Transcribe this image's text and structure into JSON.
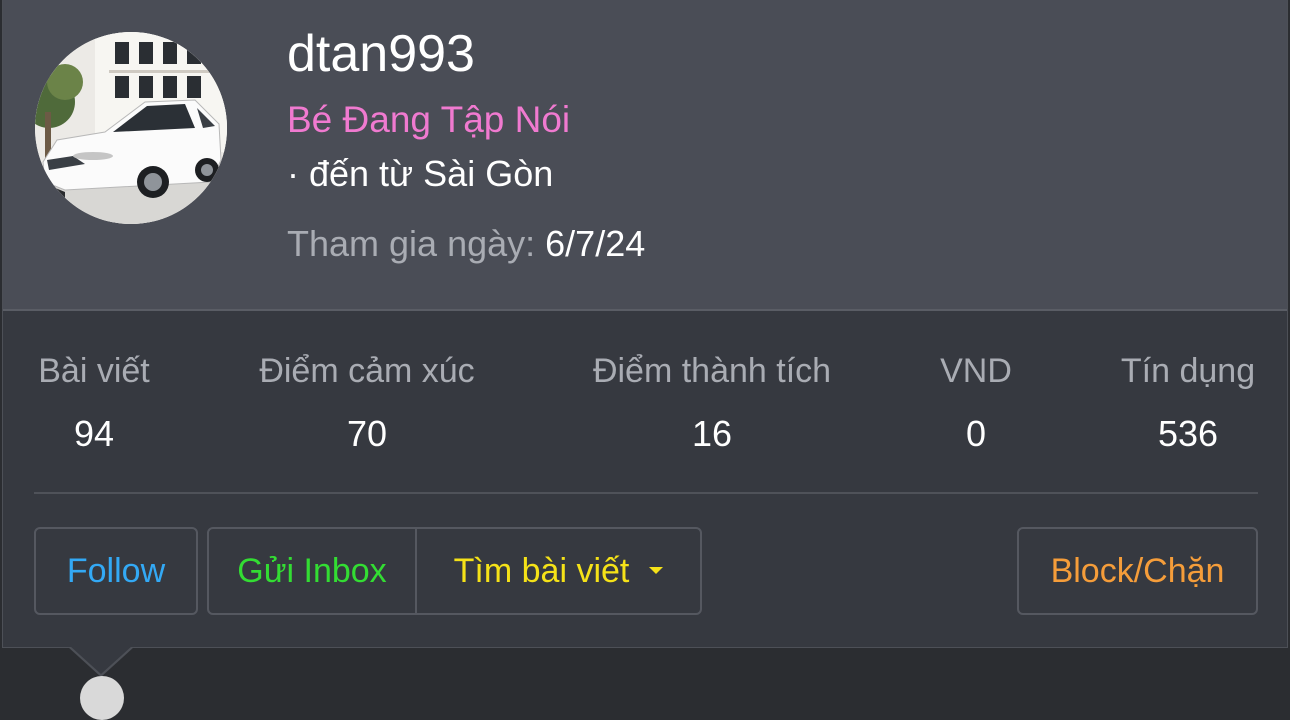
{
  "profile": {
    "username": "dtan993",
    "rank": "Bé Đang Tập Nói",
    "location": "· đến từ Sài Gòn",
    "joined_label": "Tham gia ngày:",
    "joined_value": "6/7/24",
    "avatar_icon": "car-photo-avatar"
  },
  "stats": [
    {
      "label": "Bài viết",
      "value": "94"
    },
    {
      "label": "Điểm cảm xúc",
      "value": "70"
    },
    {
      "label": "Điểm thành tích",
      "value": "16"
    },
    {
      "label": "VND",
      "value": "0"
    },
    {
      "label": "Tín dụng",
      "value": "536"
    }
  ],
  "actions": {
    "follow": "Follow",
    "inbox": "Gửi Inbox",
    "find_posts": "Tìm bài viết",
    "block": "Block/Chặn"
  },
  "colors": {
    "rank": "#f07ad0",
    "follow": "#33a9f5",
    "inbox": "#33dd33",
    "find_posts": "#f5e218",
    "block": "#f59d3a"
  }
}
